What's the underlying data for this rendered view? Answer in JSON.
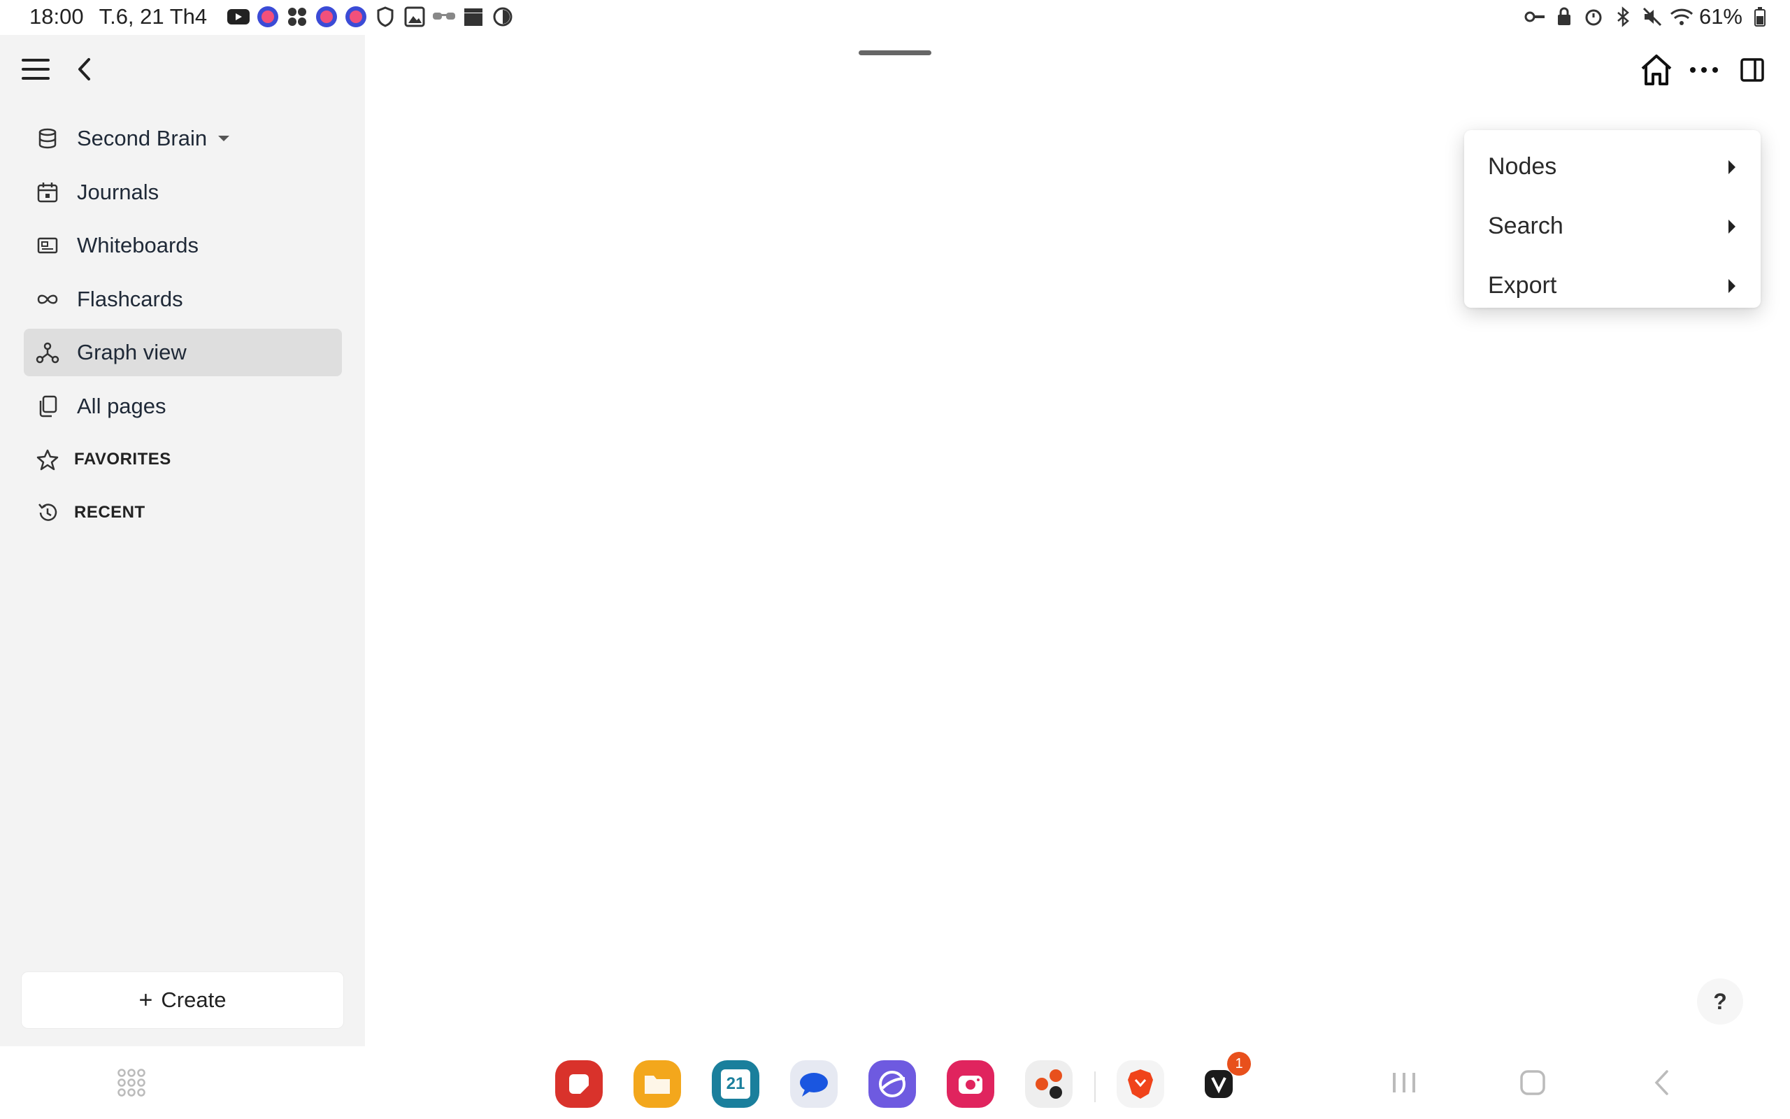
{
  "status_bar": {
    "time": "18:00",
    "date": "T.6, 21 Th4",
    "battery": "61%"
  },
  "sidebar": {
    "items": [
      {
        "label": "Second Brain",
        "icon": "database-icon"
      },
      {
        "label": "Journals",
        "icon": "calendar-icon"
      },
      {
        "label": "Whiteboards",
        "icon": "whiteboard-icon"
      },
      {
        "label": "Flashcards",
        "icon": "infinity-icon"
      },
      {
        "label": "Graph view",
        "icon": "graph-icon",
        "active": true
      },
      {
        "label": "All pages",
        "icon": "pages-icon"
      }
    ],
    "sections": [
      {
        "label": "FAVORITES",
        "icon": "star-icon"
      },
      {
        "label": "RECENT",
        "icon": "history-icon"
      }
    ],
    "create_label": "Create"
  },
  "menu": {
    "items": [
      {
        "label": "Nodes"
      },
      {
        "label": "Search"
      },
      {
        "label": "Export"
      }
    ]
  },
  "help": {
    "label": "?"
  },
  "taskbar": {
    "calendar_day": "21",
    "notification_count": "1"
  }
}
